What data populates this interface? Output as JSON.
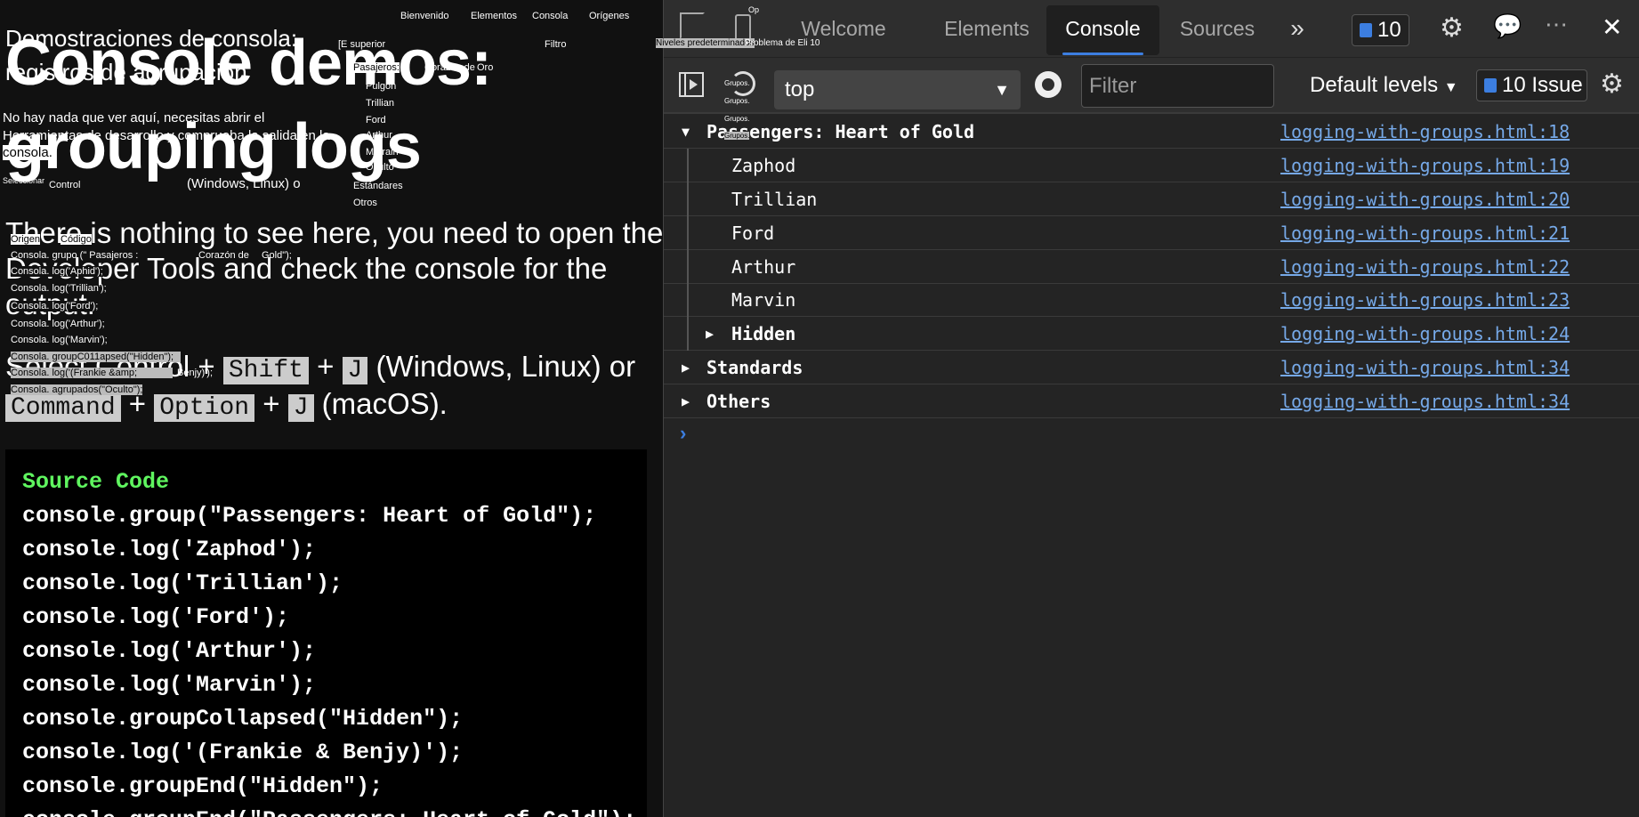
{
  "page": {
    "heading_lines": [
      "Console demos:",
      "grouping logs"
    ],
    "paragraph_lines": [
      "There is nothing to see here, you need to open the",
      "Developer Tools and check the console for the",
      "output."
    ],
    "shortcut_line1": {
      "prefix": "Select Control + ",
      "k1": "Shift",
      "plus": "+",
      "k2": "J",
      "suffix": " (Windows, Linux) or"
    },
    "shortcut_line2": {
      "k1": "Command",
      "plus1": "+",
      "k2": "Option",
      "plus2": "+",
      "k3": "J",
      "suffix": " (macOS)."
    },
    "code_title": "Source Code",
    "code_lines": [
      "console.group(\"Passengers: Heart of Gold\");",
      "console.log('Zaphod');",
      "console.log('Trillian');",
      "console.log('Ford');",
      "console.log('Arthur');",
      "console.log('Marvin');",
      "console.groupCollapsed(\"Hidden\");",
      "console.log('(Frankie & Benjy)');",
      "console.groupEnd(\"Hidden\");",
      "console.groupEnd(\"Passengers: Heart of Gold\");"
    ]
  },
  "translation_overlay": {
    "tabs": [
      "Bienvenido",
      "Elementos",
      "Consola",
      "Orígenes"
    ],
    "heading": [
      "Demostraciones de consola:",
      "registros de agrupación"
    ],
    "top_select": "[E superior",
    "filter": "Filtro",
    "levels": "Niveles predeterminados",
    "op": "Op",
    "issues": "Problema de Eli 10",
    "passengers": "Pasajeros:",
    "heart_of": "Corazón de",
    "gold": "Oro",
    "console_items": [
      "Pulgón",
      "Trillian",
      "Ford",
      "Arthur",
      "Ma rain",
      "Oculto",
      "Estándares",
      "Otros"
    ],
    "paragraph": [
      "No hay nada que ver aquí, necesitas abrir el",
      "Herramientas de desarrollo y comprueba la salida en la",
      "consola."
    ],
    "shortcut": [
      "Seleccionar",
      "Control",
      "(Windows, Linux) o"
    ],
    "code_header": [
      "Origen",
      "Código"
    ],
    "code_group": [
      "Consola. grupo (\" Pasajeros :",
      "Corazón de",
      "Gold\");"
    ],
    "code_lines": [
      "Consola. log('Aphid');",
      "Consola. log('Trillian');",
      "Consola. log('Ford');",
      "Consola. log('Arthur');",
      "Consola. log('Marvin');",
      "Consola. groupC011apsed(\"Hidden\");",
      "Consola. log('(Frankie &amp;",
      "Benjy)');",
      "Consola. agrupados(\"Oculto\");"
    ],
    "groups_label": "Grupos."
  },
  "devtools": {
    "tabs": [
      {
        "label": "Welcome",
        "active": false
      },
      {
        "label": "Elements",
        "active": false
      },
      {
        "label": "Console",
        "active": true
      },
      {
        "label": "Sources",
        "active": false
      }
    ],
    "more_tabs": "»",
    "issues_count": "10",
    "context": "top",
    "filter_placeholder": "Filter",
    "levels": "Default levels",
    "issues_label": "10 Issue",
    "accent": "#3c7ee0",
    "link_color": "#76a9e8",
    "messages": [
      {
        "text": "Passengers: Heart of Gold",
        "source": "logging-with-groups.html:18",
        "group": true,
        "expanded": true,
        "indent": 0
      },
      {
        "text": "Zaphod",
        "source": "logging-with-groups.html:19",
        "indent": 1
      },
      {
        "text": "Trillian",
        "source": "logging-with-groups.html:20",
        "indent": 1
      },
      {
        "text": "Ford",
        "source": "logging-with-groups.html:21",
        "indent": 1
      },
      {
        "text": "Arthur",
        "source": "logging-with-groups.html:22",
        "indent": 1
      },
      {
        "text": "Marvin",
        "source": "logging-with-groups.html:23",
        "indent": 1
      },
      {
        "text": "Hidden",
        "source": "logging-with-groups.html:24",
        "group": true,
        "expanded": false,
        "indent": 1
      },
      {
        "text": "Standards",
        "source": "logging-with-groups.html:34",
        "group": true,
        "expanded": false,
        "indent": 0
      },
      {
        "text": "Others",
        "source": "logging-with-groups.html:34",
        "group": true,
        "expanded": false,
        "indent": 0
      }
    ]
  }
}
